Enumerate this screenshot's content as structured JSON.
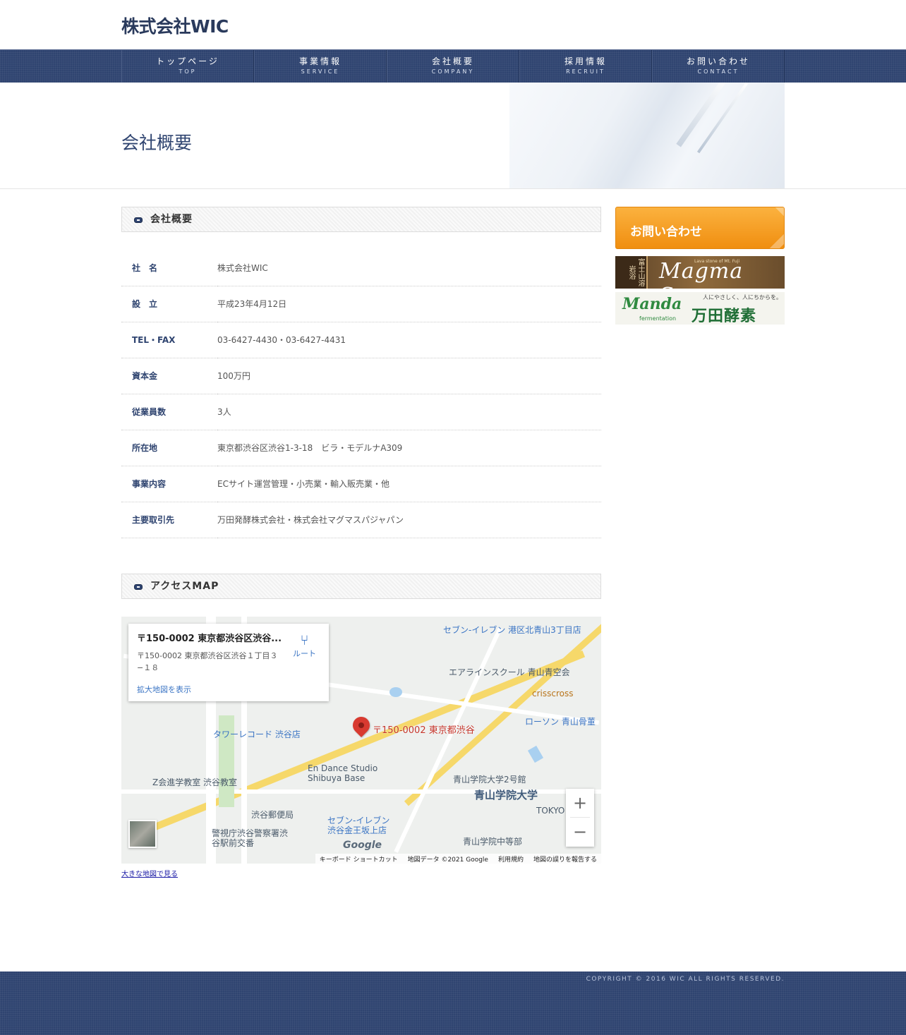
{
  "header": {
    "logo": "株式会社WIC"
  },
  "nav": [
    {
      "jp": "トップページ",
      "en": "TOP"
    },
    {
      "jp": "事業情報",
      "en": "SERVICE"
    },
    {
      "jp": "会社概要",
      "en": "COMPANY"
    },
    {
      "jp": "採用情報",
      "en": "RECRUIT"
    },
    {
      "jp": "お問い合わせ",
      "en": "CONTACT"
    }
  ],
  "page_title": "会社概要",
  "company_section": {
    "title": "会社概要",
    "rows": [
      {
        "label": "社　名",
        "value": "株式会社WIC"
      },
      {
        "label": "設　立",
        "value": "平成23年4月12日"
      },
      {
        "label": "TEL・FAX",
        "value": "03-6427-4430・03-6427-4431"
      },
      {
        "label": "資本金",
        "value": "100万円"
      },
      {
        "label": "従業員数",
        "value": "3人"
      },
      {
        "label": "所在地",
        "value": "東京都渋谷区渋谷1-3-18　ビラ・モデルナA309"
      },
      {
        "label": "事業内容",
        "value": "ECサイト運営管理・小売業・輸入販売業・他"
      },
      {
        "label": "主要取引先",
        "value": "万田発酵株式会社・株式会社マグマスパジャパン"
      }
    ]
  },
  "map_section": {
    "title": "アクセスMAP",
    "card_title": "〒150-0002 東京都渋谷区渋谷...",
    "card_address": "〒150-0002 東京都渋谷区渋谷１丁目３−１８",
    "card_link": "拡大地図を表示",
    "route_label": "ルート",
    "pin_label": "〒150-0002 東京都渋谷",
    "labels": [
      "セブン-イレブン 港区北青山3丁目店",
      "エアラインスクール 青山青空会",
      "crisscross",
      "ローソン 青山骨董",
      "タワーレコード 渋谷店",
      "En Dance Studio Shibuya Base",
      "Z会進学教室 渋谷教室",
      "青山学院大学2号館",
      "青山学院大学",
      "渋谷郵便局",
      "セブン-イレブン 渋谷金王坂上店",
      "青山学院中等部",
      "警視庁渋谷警察署渋谷駅前交番",
      "TOKYO"
    ],
    "google_logo": "Google",
    "attribution": [
      "キーボード ショートカット",
      "地図データ ©2021 Google",
      "利用規約",
      "地図の誤りを報告する"
    ],
    "big_map_link": "大きな地図で見る"
  },
  "sidebar": {
    "contact_button": "お問い合わせ",
    "magma_banner": {
      "seal": "富士山溶岩浴",
      "name": "Magma Spa",
      "sub": "Lava stone of Mt. Fuji"
    },
    "manda_banner": {
      "logo": "Manda",
      "sub": "fermentation",
      "tagline": "人にやさしく、人にちからを。",
      "name": "万田酵素"
    }
  },
  "footer": {
    "copyright": "COPYRIGHT © 2016 WIC ALL RIGHTS RESERVED."
  },
  "colors": {
    "navy": "#2f4470",
    "accent_orange": "#f5a024"
  }
}
